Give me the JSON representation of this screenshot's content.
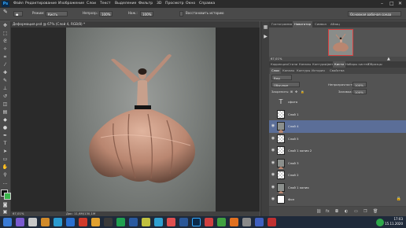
{
  "menubar": {
    "logo": "Ps",
    "items": [
      "Файл",
      "Редактирование",
      "Изображение",
      "Слои",
      "Текст",
      "Выделение",
      "Фильтр",
      "3D",
      "Просмотр",
      "Окно",
      "Справка"
    ]
  },
  "options": {
    "mode_label": "Режим:",
    "mode_value": "Кисть",
    "opacity_label": "Непрозр.:",
    "opacity_value": "100%",
    "pressure_label": "Наж.:",
    "pressure_value": "100%",
    "history_label": "Восстановить историю",
    "workspace_value": "Основная рабочая среда"
  },
  "document": {
    "tab_title": "Деформация.psd @ 67% (Слой 4, RGB/8) *",
    "zoom": "67,01%",
    "doc_size": "Док: 11,6M/130,1M"
  },
  "nav_panel": {
    "tabs": [
      "Гистограмма",
      "Навигатор",
      "Символ",
      "Абзац"
    ],
    "zoom": "67,01%"
  },
  "layers_panel": {
    "tabs": [
      "Коррекция",
      "Стили",
      "Каналы",
      "Контуры",
      "Цвет",
      "Кисти",
      "Наборы кистей",
      "Образцы"
    ],
    "tabs2": [
      "Слои",
      "Каналы",
      "Контуры",
      "История",
      "Свойства"
    ],
    "filter_label": "Вид",
    "blend_mode": "Обычные",
    "opacity_label": "Непрозрачность:",
    "opacity_value": "100%",
    "lock_label": "Закрепить:",
    "fill_label": "Заливка:",
    "fill_value": "100%",
    "layers": [
      {
        "name": "сфото",
        "type": "text",
        "selected": false
      },
      {
        "name": "Слой 1",
        "type": "empty",
        "selected": false
      },
      {
        "name": "Слой 4",
        "type": "dancer",
        "selected": true
      },
      {
        "name": "Слой 5",
        "type": "empty",
        "selected": false
      },
      {
        "name": "Слой 1 копия 2",
        "type": "empty",
        "selected": false
      },
      {
        "name": "Слой 3",
        "type": "dancer",
        "selected": false
      },
      {
        "name": "Слой 2",
        "type": "empty",
        "selected": false
      },
      {
        "name": "Слой 1 копия",
        "type": "dancer",
        "selected": false
      },
      {
        "name": "Фон",
        "type": "white",
        "selected": false
      }
    ]
  },
  "taskbar": {
    "time": "17:03",
    "date": "15.11.2020"
  }
}
